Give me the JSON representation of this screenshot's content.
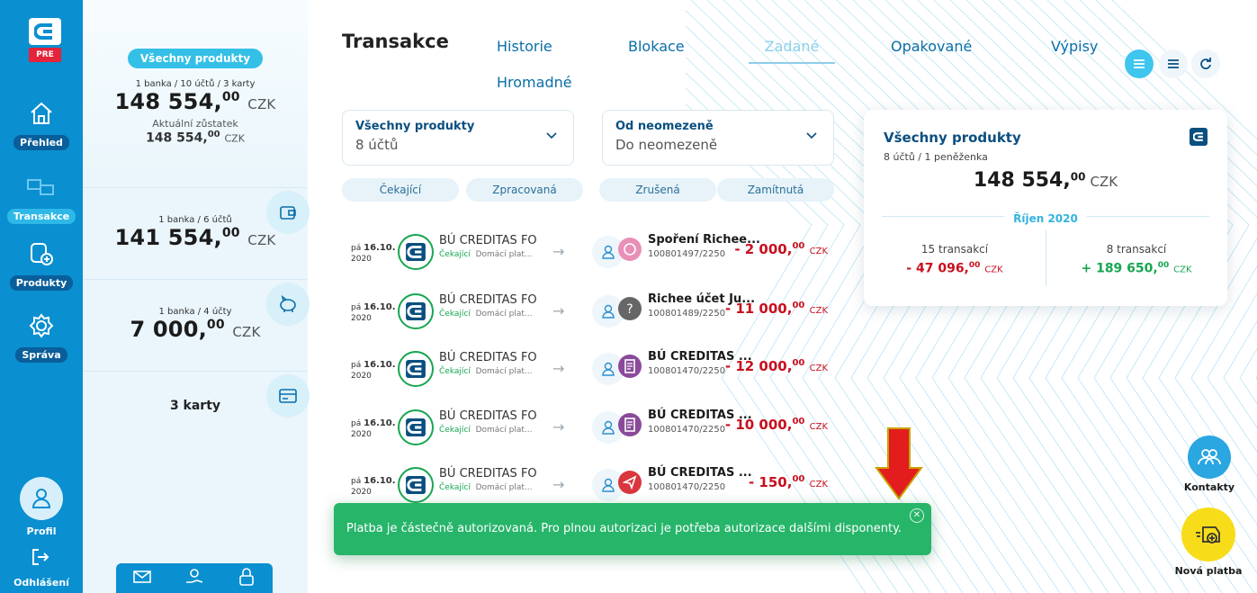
{
  "nav": {
    "logo_badge": "PRE",
    "items": [
      {
        "label": "Přehled",
        "icon": "home-icon"
      },
      {
        "label": "Transakce",
        "icon": "transfer-icon"
      },
      {
        "label": "Produkty",
        "icon": "add-product-icon"
      },
      {
        "label": "Správa",
        "icon": "gear-icon"
      }
    ],
    "profile_label": "Profil",
    "logout_label": "Odhlášení"
  },
  "products": {
    "all_pill": "Všechny produkty",
    "all_sub": "1 banka / 10 účtů / 3 karty",
    "all_amount": "148 554,",
    "all_amount_dec": "00",
    "currency": "CZK",
    "balance_label": "Aktuální zůstatek",
    "balance_amount": "148 554,",
    "balance_dec": "00",
    "group1_sub": "1 banka / 6 účtů",
    "group1_amount": "141 554,",
    "group1_dec": "00",
    "group2_sub": "1 banka / 4 účty",
    "group2_amount": "7 000,",
    "group2_dec": "00",
    "cards_label": "3 karty"
  },
  "main": {
    "title": "Transakce",
    "tabs": [
      "Historie",
      "Blokace",
      "Zadané",
      "Opakované",
      "Výpisy",
      "Hromadné"
    ],
    "active_tab": "Zadané",
    "product_select": {
      "label": "Všechny produkty",
      "value": "8 účtů"
    },
    "date_select": {
      "label": "Od neomezeně",
      "value": "Do neomezeně"
    },
    "filters": [
      "Čekající",
      "Zpracovaná",
      "Zrušená",
      "Zamítnutá"
    ]
  },
  "transactions": [
    {
      "day": "pá",
      "date": "16.10.",
      "year": "2020",
      "source": "BÚ CREDITAS FO",
      "status": "Čekající",
      "type": "Domácí plat...",
      "target": "Spoření Richee...",
      "account": "100801497/2250",
      "amount": "- 2 000,",
      "dec": "00",
      "currency": "CZK",
      "acc_color": "#e890b8",
      "acc_icon": "piggy-icon"
    },
    {
      "day": "pá",
      "date": "16.10.",
      "year": "2020",
      "source": "BÚ CREDITAS FO",
      "status": "Čekající",
      "type": "Domácí plat...",
      "target": "Richee účet Ju...",
      "account": "100801489/2250",
      "amount": "- 11 000,",
      "dec": "00",
      "currency": "CZK",
      "acc_color": "#666666",
      "acc_icon": "question-icon"
    },
    {
      "day": "pá",
      "date": "16.10.",
      "year": "2020",
      "source": "BÚ CREDITAS FO",
      "status": "Čekající",
      "type": "Domácí plat...",
      "target": "BÚ CREDITAS ...",
      "account": "100801470/2250",
      "amount": "- 12 000,",
      "dec": "00",
      "currency": "CZK",
      "acc_color": "#8a4a9a",
      "acc_icon": "document-icon"
    },
    {
      "day": "pá",
      "date": "16.10.",
      "year": "2020",
      "source": "BÚ CREDITAS FO",
      "status": "Čekající",
      "type": "Domácí plat...",
      "target": "BÚ CREDITAS ...",
      "account": "100801470/2250",
      "amount": "- 10 000,",
      "dec": "00",
      "currency": "CZK",
      "acc_color": "#8a4a9a",
      "acc_icon": "document-icon"
    },
    {
      "day": "pá",
      "date": "16.10.",
      "year": "2020",
      "source": "BÚ CREDITAS FO",
      "status": "Čekající",
      "type": "Domácí plat...",
      "target": "BÚ CREDITAS ...",
      "account": "100801470/2250",
      "amount": "- 150,",
      "dec": "00",
      "currency": "CZK",
      "acc_color": "#d9363e",
      "acc_icon": "send-icon"
    }
  ],
  "summary": {
    "title": "Všechny produkty",
    "sub": "8 účtů / 1 peněženka",
    "amount": "148 554,",
    "dec": "00",
    "currency": "CZK",
    "month": "Říjen 2020",
    "out_count": "15 transakcí",
    "out_amount": "- 47 096,",
    "out_dec": "00",
    "in_count": "8 transakcí",
    "in_amount": "+ 189 650,",
    "in_dec": "00"
  },
  "toast": {
    "message": "Platba je částečně autorizovaná. Pro plnou autorizaci je potřeba autorizace dalšími disponenty."
  },
  "fabs": {
    "contacts_label": "Kontakty",
    "new_payment_label": "Nová platba"
  },
  "colors": {
    "brand_blue": "#0a8fd0",
    "accent_cyan": "#34c0e6",
    "negative": "#c8101e",
    "positive": "#17a650",
    "toast": "#27b56a",
    "fab_yellow": "#f7dc1a"
  }
}
